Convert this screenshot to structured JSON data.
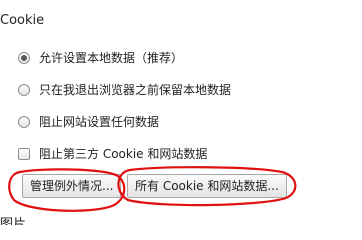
{
  "section": {
    "title": "Cookie"
  },
  "options": {
    "allow_local": "允许设置本地数据（推荐）",
    "keep_until_exit": "只在我退出浏览器之前保留本地数据",
    "block_all": "阻止网站设置任何数据",
    "block_third_party": "阻止第三方 Cookie 和网站数据"
  },
  "buttons": {
    "manage_exceptions": "管理例外情况...",
    "all_cookies": "所有 Cookie 和网站数据..."
  },
  "next_section": {
    "title_partial": "图片"
  },
  "annotation": {
    "color": "#e01010"
  }
}
